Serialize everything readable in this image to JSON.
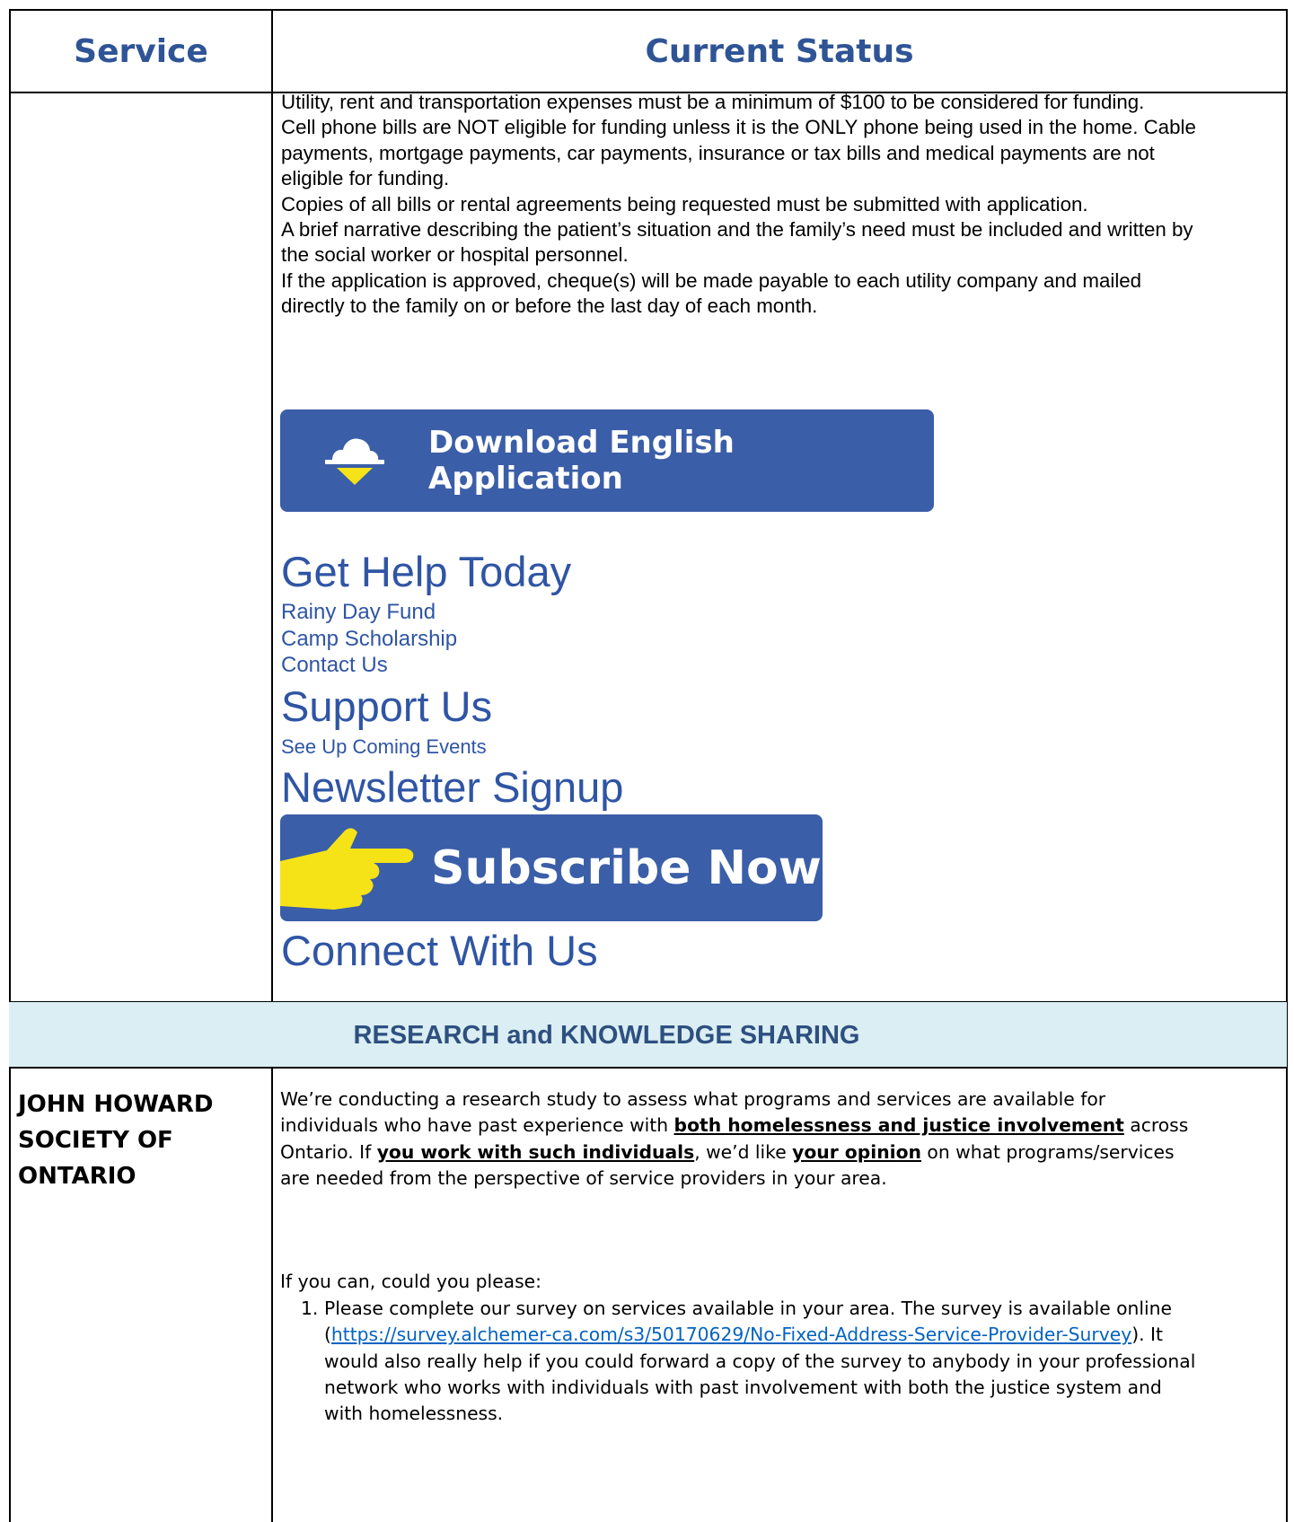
{
  "table": {
    "header": {
      "service": "Service",
      "status": "Current Status"
    },
    "rainy_day": {
      "paragraphs": [
        "Utility, rent and transportation expenses must be a minimum of $100 to be considered for funding.",
        "Cell phone bills are NOT eligible for funding unless it is the ONLY phone being used in the home. Cable payments, mortgage payments, car payments, insurance or tax bills and medical payments are not eligible for funding.",
        "Copies of all bills or rental agreements being requested must be submitted with application.",
        "A brief narrative describing the patient’s situation and the family’s need must be included and written by the social worker or hospital personnel.",
        "If the application is approved, cheque(s) will be made payable to each utility company and mailed directly to the family on or before the last day of each month."
      ],
      "download_button": "Download English Application",
      "get_help_heading": "Get Help Today",
      "get_help_links": [
        "Rainy Day Fund",
        "Camp Scholarship",
        "Contact Us"
      ],
      "support_heading": "Support Us",
      "support_link": "See Up Coming Events",
      "newsletter_heading": "Newsletter Signup",
      "subscribe_button": "Subscribe Now",
      "connect_heading": "Connect With Us"
    },
    "section_title": "RESEARCH and KNOWLEDGE SHARING",
    "research": {
      "org_name": "JOHN HOWARD SOCIETY OF ONTARIO",
      "intro_1": "We’re conducting a research study to assess what programs and services are available for individuals who have past experience with ",
      "intro_bold_1": "both homelessness and justice involvement",
      "intro_2": " across Ontario. If ",
      "intro_bold_2": "you work with such individuals",
      "intro_3": ", we’d like ",
      "intro_bold_3": "your opinion",
      "intro_4": " on what programs/services are needed from the perspective of service providers in your area.",
      "ask": "If you can, could you please:",
      "step_number": "1.",
      "step_text_1": "Please complete our survey on services available in your area. The survey is available online (",
      "survey_url": "https://survey.alchemer-ca.com/s3/50170629/No-Fixed-Address-Service-Provider-Survey",
      "step_text_2": "). It would also really help if you could forward a copy of the survey to anybody in your professional network who works with individuals with past involvement with both the justice system and with homelessness."
    }
  },
  "colors": {
    "header_text": "#2f5496",
    "button_bg": "#3b5ea8",
    "link_blue": "#2f55a4",
    "section_band": "#daeef3",
    "hand_yellow": "#f5e317"
  }
}
